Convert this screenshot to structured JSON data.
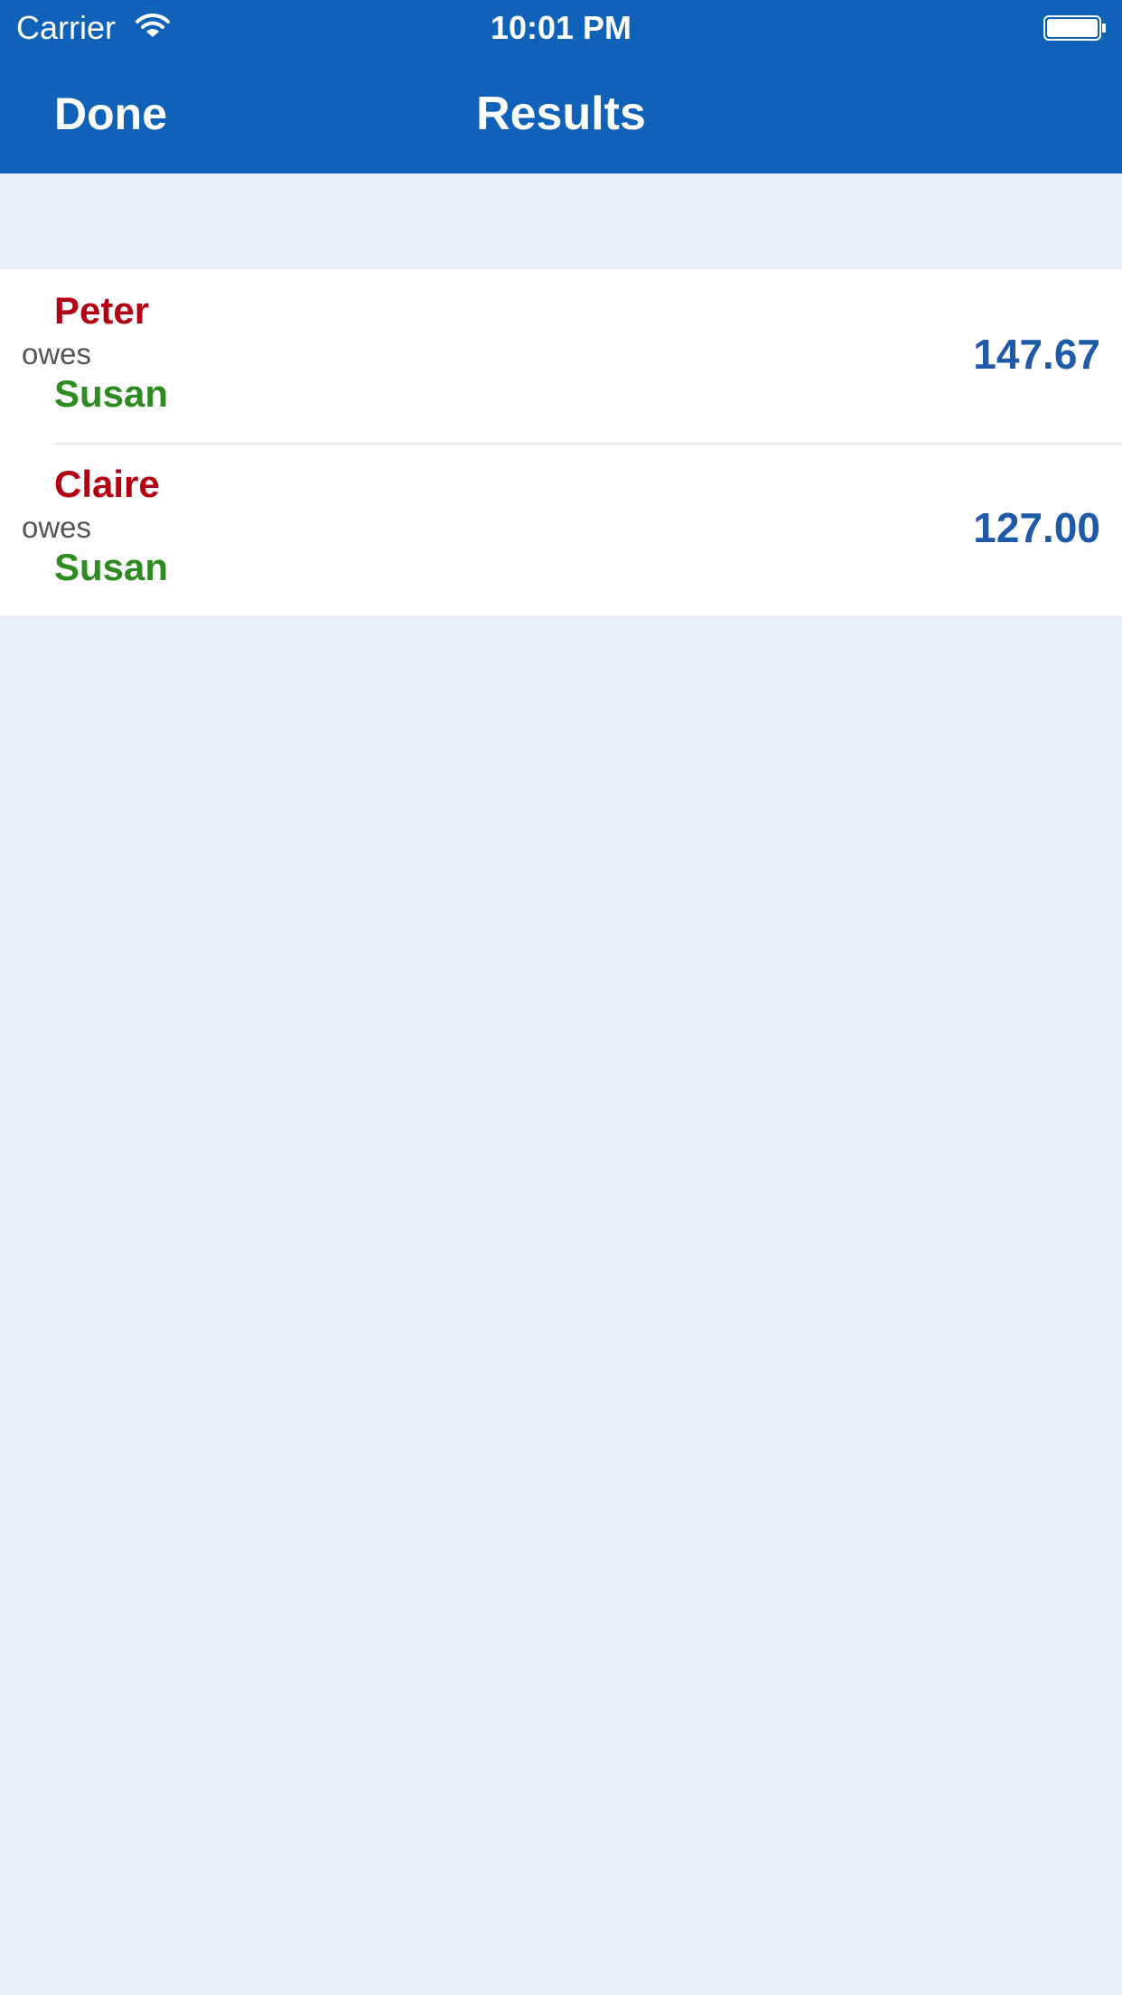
{
  "status_bar": {
    "carrier": "Carrier",
    "time": "10:01 PM",
    "wifi_icon": "wifi-icon",
    "battery_icon": "battery-icon"
  },
  "nav": {
    "done_label": "Done",
    "title": "Results"
  },
  "results": [
    {
      "debtor": "Peter",
      "verb": "owes",
      "creditor": "Susan",
      "amount": "147.67"
    },
    {
      "debtor": "Claire",
      "verb": "owes",
      "creditor": "Susan",
      "amount": "127.00"
    }
  ],
  "colors": {
    "nav_background": "#0f62b8",
    "page_background": "#e8eff8",
    "debtor": "#b30012",
    "creditor": "#2e8b22",
    "amount": "#1e5aa8"
  }
}
